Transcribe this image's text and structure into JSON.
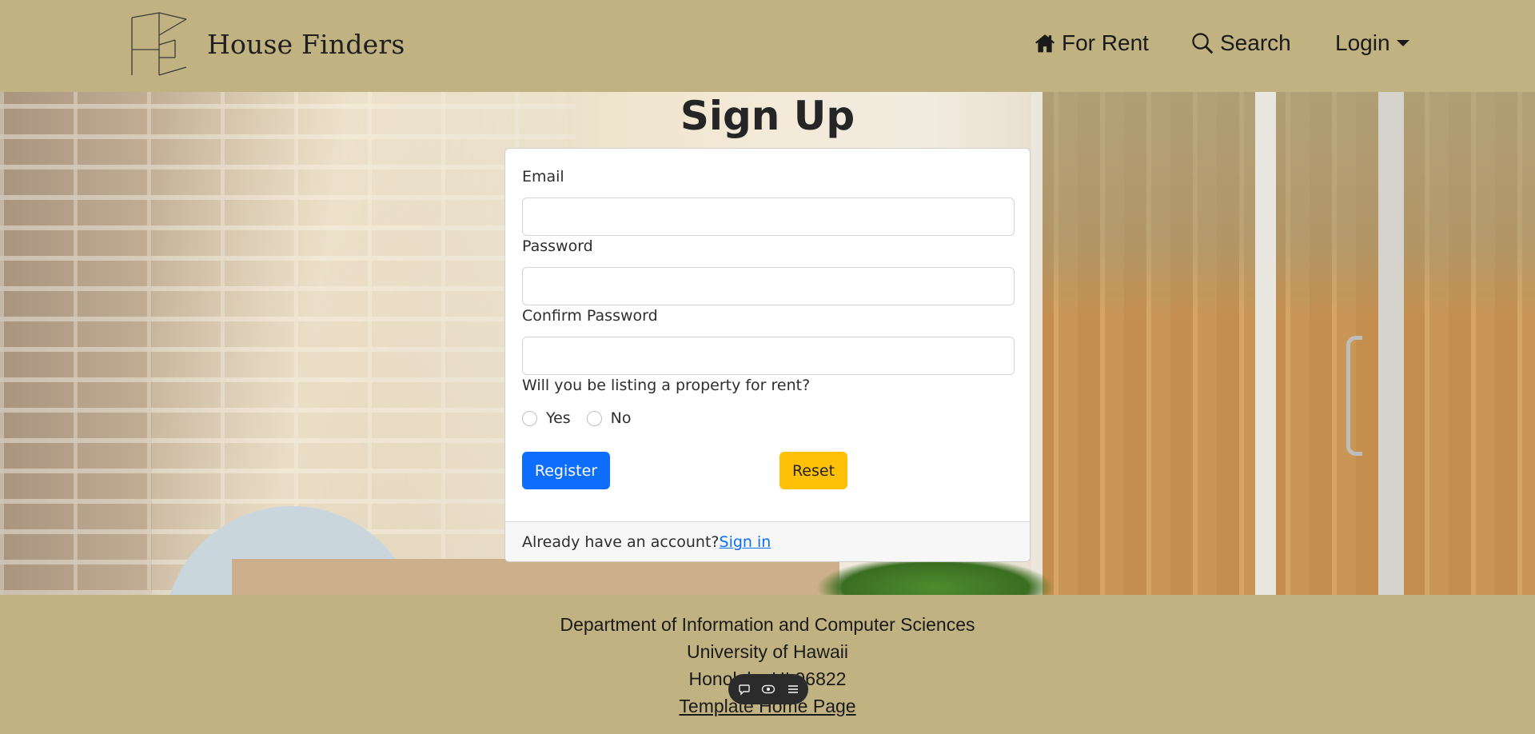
{
  "navbar": {
    "brand": "House Finders",
    "links": [
      {
        "label": "For Rent",
        "icon": "house-icon"
      },
      {
        "label": "Search",
        "icon": "search-icon"
      },
      {
        "label": "Login",
        "icon": "caret-down-icon"
      }
    ]
  },
  "page": {
    "title": "Sign Up"
  },
  "form": {
    "email_label": "Email",
    "email_value": "",
    "password_label": "Password",
    "password_value": "",
    "confirm_label": "Confirm Password",
    "confirm_value": "",
    "listing_question": "Will you be listing a property for rent?",
    "radio_yes": "Yes",
    "radio_no": "No",
    "register_label": "Register",
    "reset_label": "Reset",
    "footer_text": "Already have an account?",
    "signin_link": "Sign in"
  },
  "footer": {
    "line1": "Department of Information and Computer Sciences",
    "line2": "University of Hawaii",
    "line3": "Honolulu, HI 96822",
    "link": "Template Home Page"
  },
  "colors": {
    "navbar_bg": "#c1b281",
    "primary": "#0d6efd",
    "warning": "#ffc107"
  }
}
